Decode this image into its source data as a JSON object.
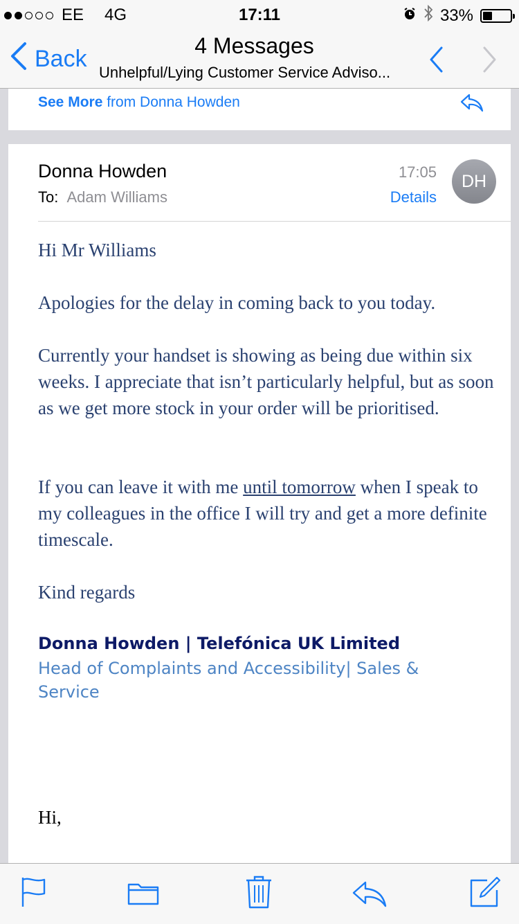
{
  "status_bar": {
    "carrier": "EE",
    "network": "4G",
    "time": "17:11",
    "battery": "33%",
    "battery_level": 0.33,
    "signal_bars": 2
  },
  "nav": {
    "back_label": "Back",
    "title": "4 Messages",
    "subtitle": "Unhelpful/Lying Customer Service Adviso..."
  },
  "previous": {
    "see_more": "See More",
    "from_text": "from Donna Howden"
  },
  "message": {
    "sender": "Donna Howden",
    "to_label": "To:",
    "to_name": "Adam Williams",
    "time": "17:05",
    "details_label": "Details",
    "avatar_initials": "DH",
    "greeting": "Hi Mr Williams",
    "para1": "Apologies for the delay in coming back to you today.",
    "para2": "Currently your handset is showing as being due within six weeks.  I appreciate that isn’t particularly helpful, but as soon as we get more stock in your order will be prioritised.",
    "para3_before": "If you can leave it with me ",
    "para3_link": "until tomorrow",
    "para3_after": " when I speak to my colleagues in the office I will try and get a more definite timescale.",
    "closing": "Kind regards",
    "signature_name": "Donna Howden  |  Telefónica UK Limited",
    "signature_role": "Head of Complaints and Accessibility| Sales & Service",
    "quoted_start": "Hi,"
  },
  "colors": {
    "accent": "#1a7cf5",
    "body_text": "#2a4170",
    "signature_name": "#0d1a66",
    "signature_role": "#4d84c4"
  },
  "icons": {
    "toolbar": [
      "flag-icon",
      "folder-icon",
      "trash-icon",
      "reply-icon",
      "compose-icon"
    ]
  }
}
